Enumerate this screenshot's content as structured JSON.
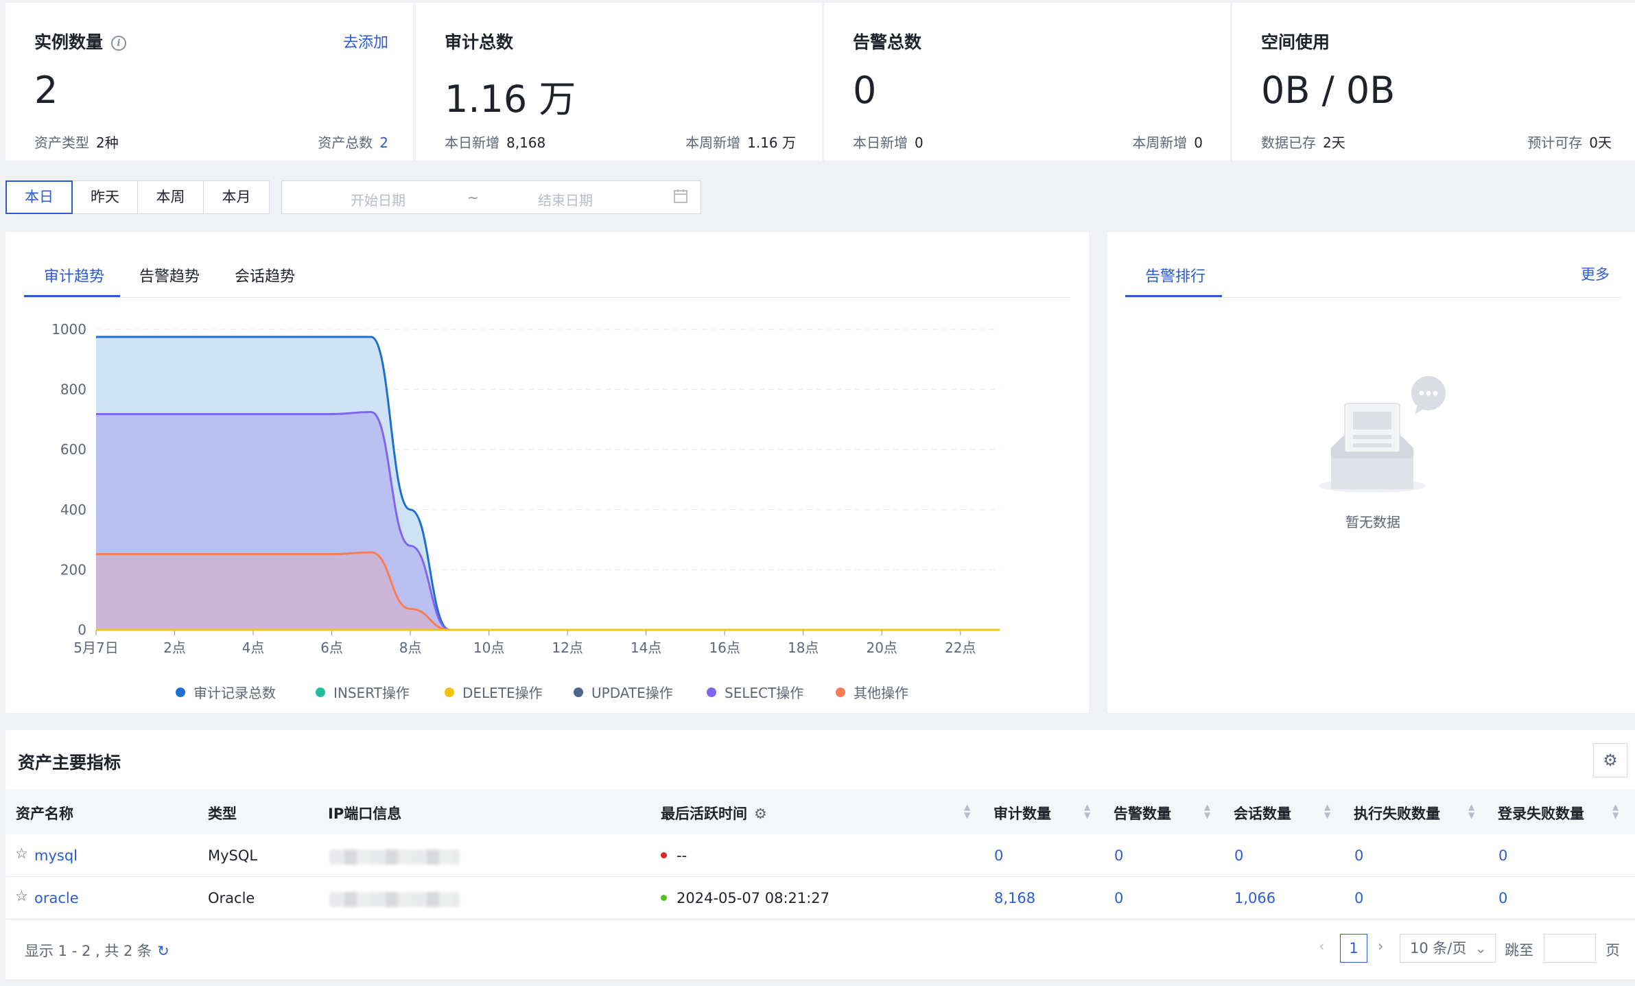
{
  "stats": [
    {
      "title": "实例数量",
      "link": "去添加",
      "value": "2",
      "sub_left_label": "资产类型",
      "sub_left_value": "2种",
      "sub_right_label": "资产总数",
      "sub_right_value": "2"
    },
    {
      "title": "审计总数",
      "value": "1.16 万",
      "sub_left_label": "本日新增",
      "sub_left_value": "8,168",
      "sub_right_label": "本周新增",
      "sub_right_value": "1.16 万"
    },
    {
      "title": "告警总数",
      "value": "0",
      "sub_left_label": "本日新增",
      "sub_left_value": "0",
      "sub_right_label": "本周新增",
      "sub_right_value": "0"
    },
    {
      "title": "空间使用",
      "value": "0B / 0B",
      "sub_left_label": "数据已存",
      "sub_left_value": "2天",
      "sub_right_label": "预计可存",
      "sub_right_value": "0天"
    }
  ],
  "time_range": {
    "buttons": [
      "本日",
      "昨天",
      "本周",
      "本月"
    ],
    "selected": "本日",
    "start_placeholder": "开始日期",
    "separator": "~",
    "end_placeholder": "结束日期"
  },
  "trend_panel": {
    "tabs": [
      "审计趋势",
      "告警趋势",
      "会话趋势"
    ],
    "active_tab": "审计趋势"
  },
  "alert_panel": {
    "tab": "告警排行",
    "more": "更多",
    "empty_text": "暂无数据"
  },
  "chart_data": {
    "type": "area",
    "x_labels": [
      "5月7日",
      "2点",
      "4点",
      "6点",
      "8点",
      "10点",
      "12点",
      "14点",
      "16点",
      "18点",
      "20点",
      "22点"
    ],
    "x_hours": [
      0,
      1,
      2,
      3,
      4,
      5,
      6,
      7,
      8,
      9,
      10,
      11,
      12,
      13,
      14,
      15,
      16,
      17,
      18,
      19,
      20,
      21,
      22,
      23
    ],
    "ylim": [
      0,
      1000
    ],
    "yticks": [
      0,
      200,
      400,
      600,
      800,
      1000
    ],
    "grid": true,
    "legend_position": "bottom",
    "series": [
      {
        "name": "审计记录总数",
        "color": "#1f6fd1",
        "fill": "#c9e0f5",
        "values": [
          975,
          975,
          975,
          975,
          975,
          975,
          975,
          975,
          400,
          0,
          0,
          0,
          0,
          0,
          0,
          0,
          0,
          0,
          0,
          0,
          0,
          0,
          0,
          0
        ]
      },
      {
        "name": "INSERT操作",
        "color": "#1fbf99",
        "fill": "none",
        "values": [
          0,
          0,
          0,
          0,
          0,
          0,
          0,
          0,
          0,
          0,
          0,
          0,
          0,
          0,
          0,
          0,
          0,
          0,
          0,
          0,
          0,
          0,
          0,
          0
        ]
      },
      {
        "name": "DELETE操作",
        "color": "#f2c40f",
        "fill": "none",
        "values": [
          0,
          0,
          0,
          0,
          0,
          0,
          0,
          0,
          0,
          0,
          0,
          0,
          0,
          0,
          0,
          0,
          0,
          0,
          0,
          0,
          0,
          0,
          0,
          0
        ]
      },
      {
        "name": "UPDATE操作",
        "color": "#4e6688",
        "fill": "none",
        "values": [
          0,
          0,
          0,
          0,
          0,
          0,
          0,
          0,
          0,
          0,
          0,
          0,
          0,
          0,
          0,
          0,
          0,
          0,
          0,
          0,
          0,
          0,
          0,
          0
        ]
      },
      {
        "name": "SELECT操作",
        "color": "#8066ee",
        "fill": "#b8bdf2",
        "values": [
          718,
          718,
          718,
          718,
          718,
          718,
          718,
          725,
          280,
          0,
          0,
          0,
          0,
          0,
          0,
          0,
          0,
          0,
          0,
          0,
          0,
          0,
          0,
          0
        ]
      },
      {
        "name": "其他操作",
        "color": "#fa7d51",
        "fill": "#cdb5d6",
        "values": [
          252,
          252,
          252,
          252,
          252,
          252,
          252,
          258,
          70,
          0,
          0,
          0,
          0,
          0,
          0,
          0,
          0,
          0,
          0,
          0,
          0,
          0,
          0,
          0
        ]
      }
    ]
  },
  "table": {
    "title": "资产主要指标",
    "columns": [
      "资产名称",
      "类型",
      "IP端口信息",
      "最后活跃时间",
      "审计数量",
      "告警数量",
      "会话数量",
      "执行失败数量",
      "登录失败数量"
    ],
    "rows": [
      {
        "name": "mysql",
        "type": "MySQL",
        "status_color": "#e0262b",
        "last_active": "--",
        "audit": "0",
        "alert": "0",
        "session": "0",
        "exec_fail": "0",
        "login_fail": "0"
      },
      {
        "name": "oracle",
        "type": "Oracle",
        "status_color": "#52c41a",
        "last_active": "2024-05-07 08:21:27",
        "audit": "8,168",
        "alert": "0",
        "session": "1,066",
        "exec_fail": "0",
        "login_fail": "0"
      }
    ],
    "summary": "显示 1 - 2 , 共 2 条",
    "pagination": {
      "current_page": "1",
      "page_size": "10 条/页",
      "jump_label": "跳至",
      "page_suffix": "页"
    }
  }
}
